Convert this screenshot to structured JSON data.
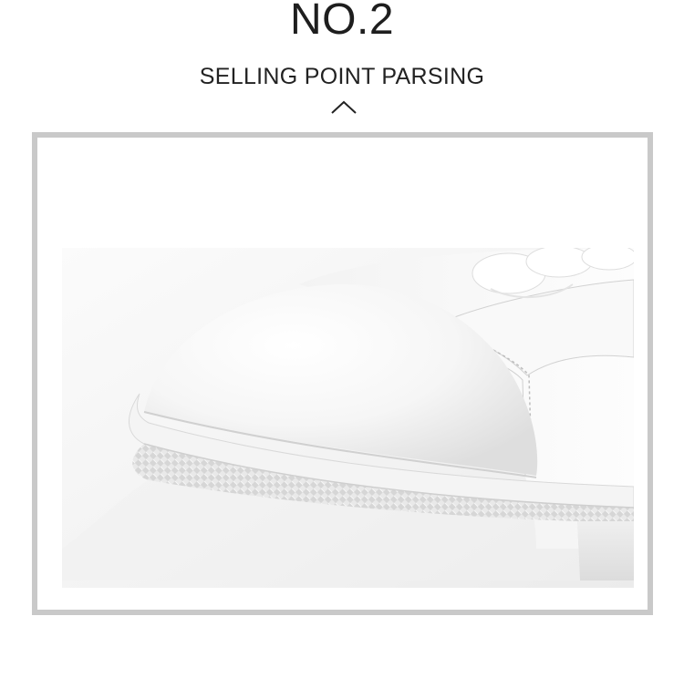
{
  "heading": {
    "number": "NO.2",
    "subtitle": "SELLING POINT PARSING",
    "caret_icon": "chevron-up-icon"
  },
  "photo": {
    "subject": "sneaker-toe-photo",
    "colors": {
      "frame_border": "#c9c9c9",
      "background": "#ffffff",
      "leather": "#f7f7f7",
      "sole": "#e8e8e8"
    }
  }
}
